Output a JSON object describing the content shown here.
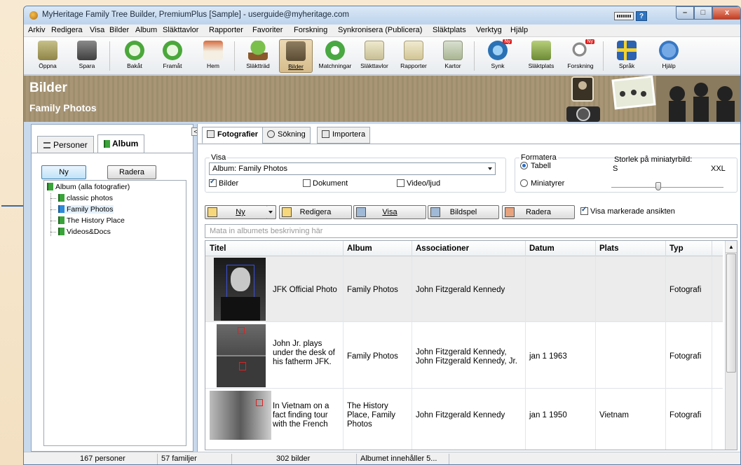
{
  "window": {
    "title": "MyHeritage Family Tree Builder, PremiumPlus [Sample] - userguide@myheritage.com",
    "controls": {
      "minimize": "–",
      "maximize": "□",
      "close": "x"
    },
    "help_square": "?"
  },
  "menu": [
    "Arkiv",
    "Redigera",
    "Visa",
    "Bilder",
    "Album",
    "Släkttavlor",
    "Rapporter",
    "Favoriter",
    "Forskning",
    "Synkronisera (Publicera)",
    "Släktplats",
    "Verktyg",
    "Hjälp"
  ],
  "toolbar": {
    "items": [
      {
        "label": "Öppna",
        "icon": "folder-open-icon",
        "color": "#9a8f4a"
      },
      {
        "label": "Spara",
        "icon": "save-disk-icon",
        "color": "#555555"
      },
      {
        "label": "Bakåt",
        "icon": "back-arrow-icon",
        "color": "#4aa83a"
      },
      {
        "label": "Framåt",
        "icon": "forward-arrow-icon",
        "color": "#4aa83a"
      },
      {
        "label": "Hem",
        "icon": "home-icon",
        "color": "#b5542d"
      },
      {
        "label": "Släktträd",
        "icon": "family-tree-icon",
        "color": "#4d9a35"
      },
      {
        "label": "Bilder",
        "icon": "photos-icon",
        "color": "#7a6d55"
      },
      {
        "label": "Matchningar",
        "icon": "matches-icon",
        "color": "#49a842"
      },
      {
        "label": "Släkttavlor",
        "icon": "charts-icon",
        "color": "#d0c9a3"
      },
      {
        "label": "Rapporter",
        "icon": "reports-icon",
        "color": "#d8cfa0"
      },
      {
        "label": "Kartor",
        "icon": "maps-icon",
        "color": "#b7c2a4"
      },
      {
        "label": "Synk",
        "icon": "sync-icon",
        "color": "#2b72b5"
      },
      {
        "label": "Släktplats",
        "icon": "family-site-icon",
        "color": "#7d9d3a"
      },
      {
        "label": "Forskning",
        "icon": "research-icon",
        "color": "#8a8a8a"
      },
      {
        "label": "Språk",
        "icon": "swedish-flag-icon",
        "color": "#2c62b0"
      },
      {
        "label": "Hjälp",
        "icon": "help-icon",
        "color": "#3778c4"
      }
    ],
    "badge": "Ny"
  },
  "banner": {
    "title": "Bilder",
    "subtitle": "Family Photos",
    "bg": "#a08f6f"
  },
  "left": {
    "collapse": "<",
    "tabs": [
      "Personer",
      "Album"
    ],
    "buttons": {
      "new": "Ny",
      "delete": "Radera"
    },
    "tree": {
      "root": "Album (alla fotografier)",
      "children": [
        "classic photos",
        "Family Photos",
        "The History Place",
        "Videos&Docs"
      ]
    }
  },
  "right": {
    "tabs": [
      "Fotografier",
      "Sökning",
      "Importera"
    ],
    "visa": {
      "legend": "Visa",
      "select": "Album: Family Photos",
      "checks": [
        {
          "label": "Bilder",
          "checked": true
        },
        {
          "label": "Dokument",
          "checked": false
        },
        {
          "label": "Video/ljud",
          "checked": false
        }
      ]
    },
    "format": {
      "legend": "Formatera",
      "radios": [
        {
          "label": "Tabell",
          "checked": true
        },
        {
          "label": "Miniatyrer",
          "checked": false
        }
      ],
      "size_label": "Storlek på miniatyrbild:",
      "size_min": "S",
      "size_max": "XXL",
      "size_level": 0.42
    },
    "actions": [
      "Ny",
      "Redigera",
      "Visa",
      "Bildspel",
      "Radera"
    ],
    "show_faces": {
      "label": "Visa markerade ansikten",
      "checked": true
    },
    "desc_placeholder": "Mata in albumets beskrivning här",
    "columns": [
      "Titel",
      "Album",
      "Associationer",
      "Datum",
      "Plats",
      "Typ"
    ],
    "rows": [
      {
        "title": "JFK Official Photo",
        "album": "Family Photos",
        "assoc": "John Fitzgerald Kennedy",
        "date": "",
        "place": "",
        "type": "Fotografi"
      },
      {
        "title": "John Jr. plays under the desk of his fatherm JFK.",
        "album": "Family Photos",
        "assoc": "John Fitzgerald Kennedy, John Fitzgerald Kennedy, Jr.",
        "date": "jan 1 1963",
        "place": "",
        "type": "Fotografi"
      },
      {
        "title": "In Vietnam on a fact finding tour with the French",
        "album": "The History Place, Family Photos",
        "assoc": "John Fitzgerald Kennedy",
        "date": "jan 1 1950",
        "place": "Vietnam",
        "type": "Fotografi"
      }
    ]
  },
  "status": [
    "167 personer",
    "57 familjer",
    "302 bilder",
    "Albumet innehåller 5..."
  ]
}
